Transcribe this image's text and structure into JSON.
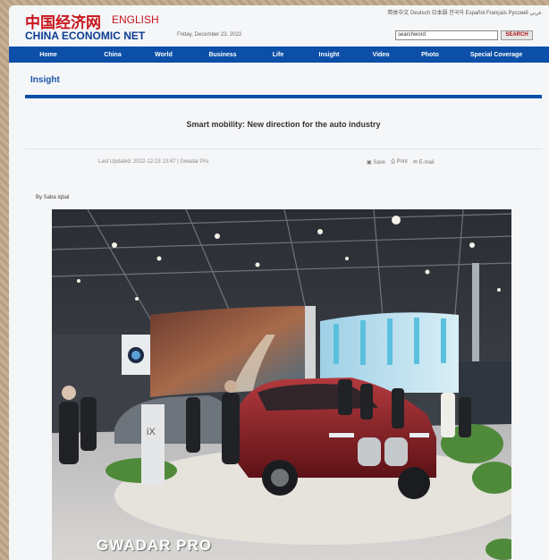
{
  "site": {
    "logo_cn": "中国经济网",
    "logo_en": "ENGLISH",
    "logo_sub": "CHINA ECONOMIC NET",
    "date": "Friday, December 23, 2022",
    "top_links": "简体中文 Deutsch 日本語 한국어 Español Français Русский عربي",
    "search_value": "searchword",
    "search_button": "SEARCH"
  },
  "nav": {
    "items": [
      "Home",
      "China",
      "World",
      "Business",
      "Life",
      "Insight",
      "Video",
      "Photo",
      "Special Coverage"
    ]
  },
  "section": {
    "title": "Insight"
  },
  "article": {
    "headline": "Smart mobility: New direction for the auto industry",
    "updated": "Last Updated: 2022-12-23 13:47 | Gwadar Pro",
    "tools": [
      "Save",
      "Print",
      "E-mail"
    ],
    "byline": "By Saba Iqbal"
  },
  "photo": {
    "watermark": "GWADAR PRO",
    "booth_sign": "iX"
  },
  "colors": {
    "brand_red": "#c8161d",
    "brand_blue": "#0b4fa8",
    "car_red": "#8c1f24"
  }
}
